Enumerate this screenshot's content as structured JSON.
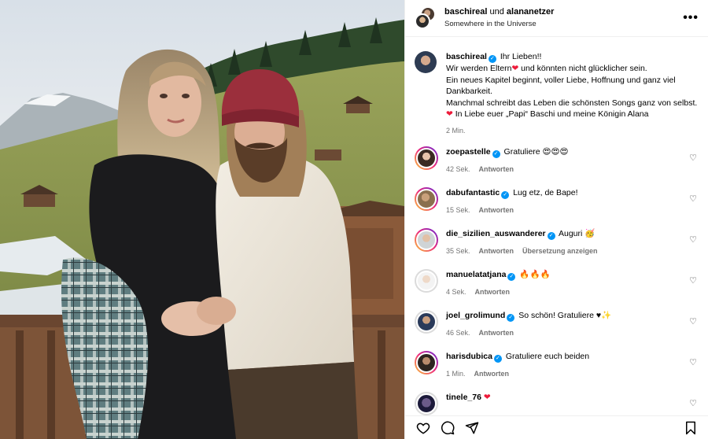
{
  "header": {
    "user1": "baschireal",
    "connector": "und",
    "user2": "alananetzer",
    "location": "Somewhere in the Universe",
    "more_label": "•••"
  },
  "caption": {
    "username": "baschireal",
    "lines": [
      "Ihr Lieben!!",
      "Wir werden Eltern",
      " und könnten nicht glücklicher sein.",
      "Ein neues Kapitel beginnt, voller Liebe, Hoffnung und ganz viel",
      "Dankbarkeit.",
      "Manchmal schreibt das Leben die schönsten Songs ganz von selbst.",
      " In Liebe euer „Papi“ Baschi und meine Königin Alana"
    ],
    "heart": "❤",
    "time": "2 Min."
  },
  "comments": [
    {
      "username": "zoepastelle",
      "text": "Gratuliere 😍😍😍",
      "time": "42 Sek.",
      "reply": "Antworten",
      "extra": ""
    },
    {
      "username": "dabufantastic",
      "text": "Lug etz, de Bape!",
      "time": "15 Sek.",
      "reply": "Antworten",
      "extra": ""
    },
    {
      "username": "die_sizilien_auswanderer",
      "text": "Auguri 🥳",
      "time": "35 Sek.",
      "reply": "Antworten",
      "extra": "Übersetzung anzeigen"
    },
    {
      "username": "manuelatatjana",
      "text": "🔥🔥🔥",
      "time": "4 Sek.",
      "reply": "Antworten",
      "extra": ""
    },
    {
      "username": "joel_grolimund",
      "text": "So schön! Gratuliere ♥✨",
      "time": "46 Sek.",
      "reply": "Antworten",
      "extra": ""
    },
    {
      "username": "harisdubica",
      "text": "Gratuliere euch beiden",
      "time": "1 Min.",
      "reply": "Antworten",
      "extra": ""
    },
    {
      "username": "tinele_76",
      "text": "❤",
      "time": "",
      "reply": "",
      "extra": ""
    }
  ],
  "colors": {
    "verified": "#0095f6",
    "heart": "#ed1b3a",
    "muted": "#737373",
    "divider": "#efefef"
  },
  "icons": [
    "like-icon",
    "comment-icon",
    "share-icon",
    "save-icon",
    "more-icon",
    "verified-icon"
  ]
}
